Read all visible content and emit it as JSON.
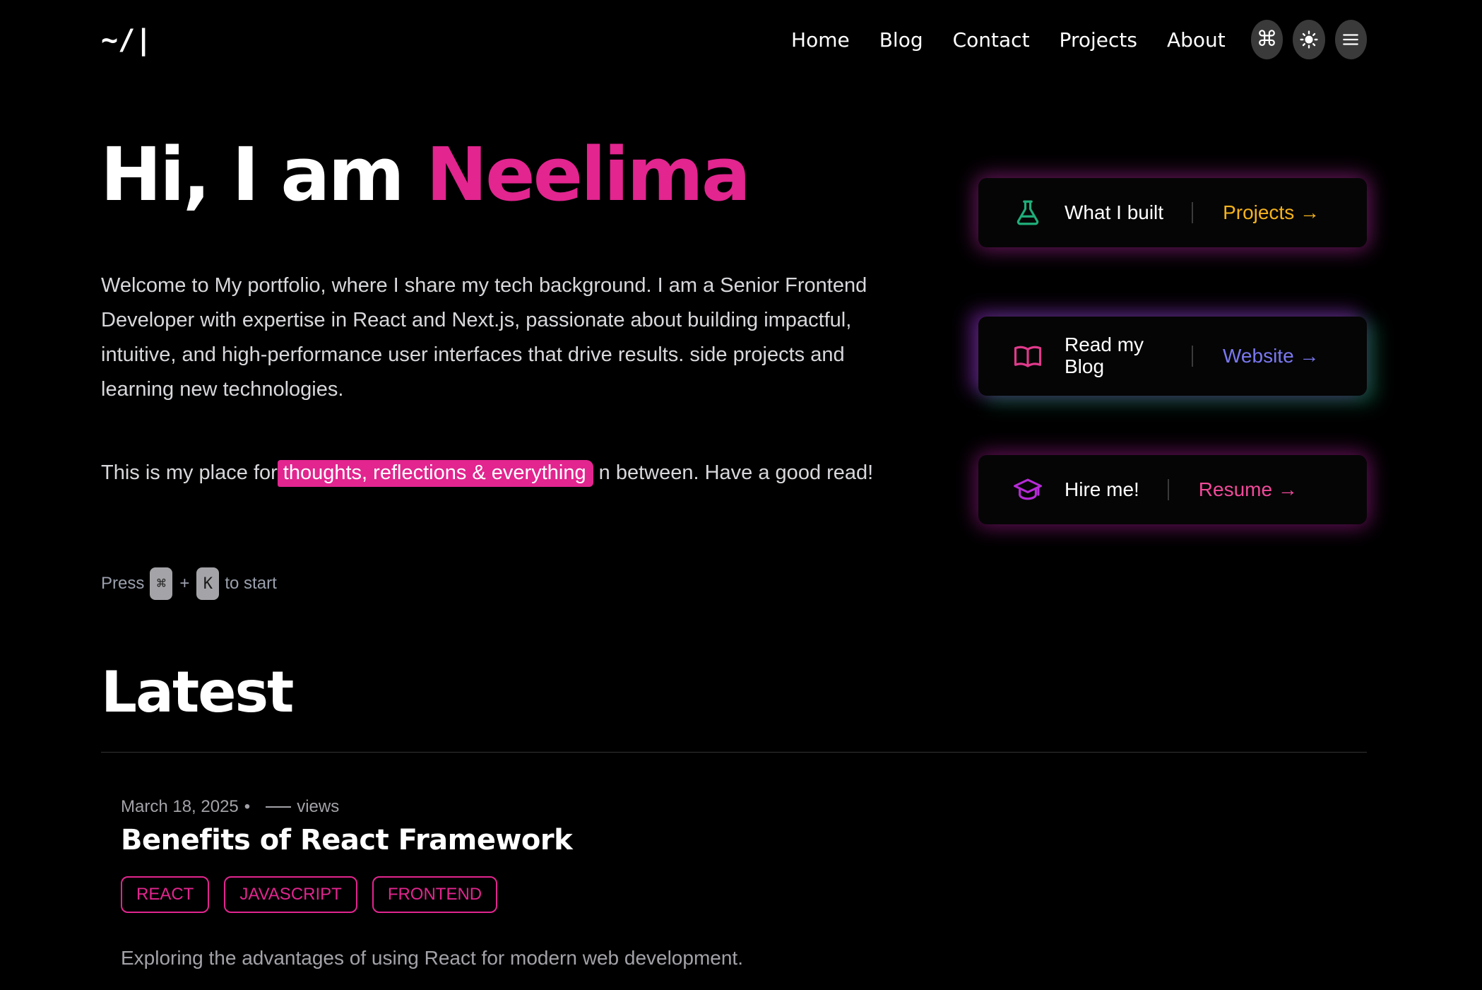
{
  "header": {
    "logo": "~/|",
    "nav": [
      "Home",
      "Blog",
      "Contact",
      "Projects",
      "About"
    ],
    "buttons": {
      "command_glyph": "⌘",
      "command_icon": "command-icon",
      "theme_icon": "sun-icon",
      "menu_icon": "menu-icon"
    }
  },
  "hero": {
    "greeting": "Hi, I am",
    "name": "Neelima",
    "intro": "Welcome to My portfolio, where I share my tech background. I am a Senior Frontend Developer with expertise in React and Next.js, passionate about building impactful, intuitive, and high-performance user interfaces that drive results. side projects and learning new technologies.",
    "tagline_before": "This is my place for",
    "tagline_highlight": "thoughts, reflections & everything",
    "tagline_after": "n between. Have a good read!",
    "press_label": "Press",
    "key_cmd": "⌘",
    "plus": "+",
    "key_k": "K",
    "to_start": "to start"
  },
  "cards": [
    {
      "icon": "flask-icon",
      "label": "What I built",
      "link": "Projects →",
      "link_color": "#f5b21c"
    },
    {
      "icon": "book-icon",
      "label": "Read my Blog",
      "link": "Website →",
      "link_color": "#7a78f0"
    },
    {
      "icon": "graduation-cap-icon",
      "label": "Hire me!",
      "link": "Resume →",
      "link_color": "#f04a9a"
    }
  ],
  "latest": {
    "title": "Latest",
    "posts": [
      {
        "date": "March 18, 2025",
        "separator": "•",
        "views": "views",
        "title": "Benefits of React Framework",
        "tags": [
          "REACT",
          "JAVASCRIPT",
          "FRONTEND"
        ],
        "excerpt": "Exploring the advantages of using React for modern web development."
      }
    ]
  },
  "colors": {
    "background": "#000000",
    "accent": "#e2258f",
    "projects_link": "#f5b21c",
    "website_link": "#7a78f0",
    "resume_link": "#f04a9a",
    "flask_icon": "#1fae7a",
    "book_icon": "#e03a8c",
    "cap_icon": "#b52bd6"
  }
}
